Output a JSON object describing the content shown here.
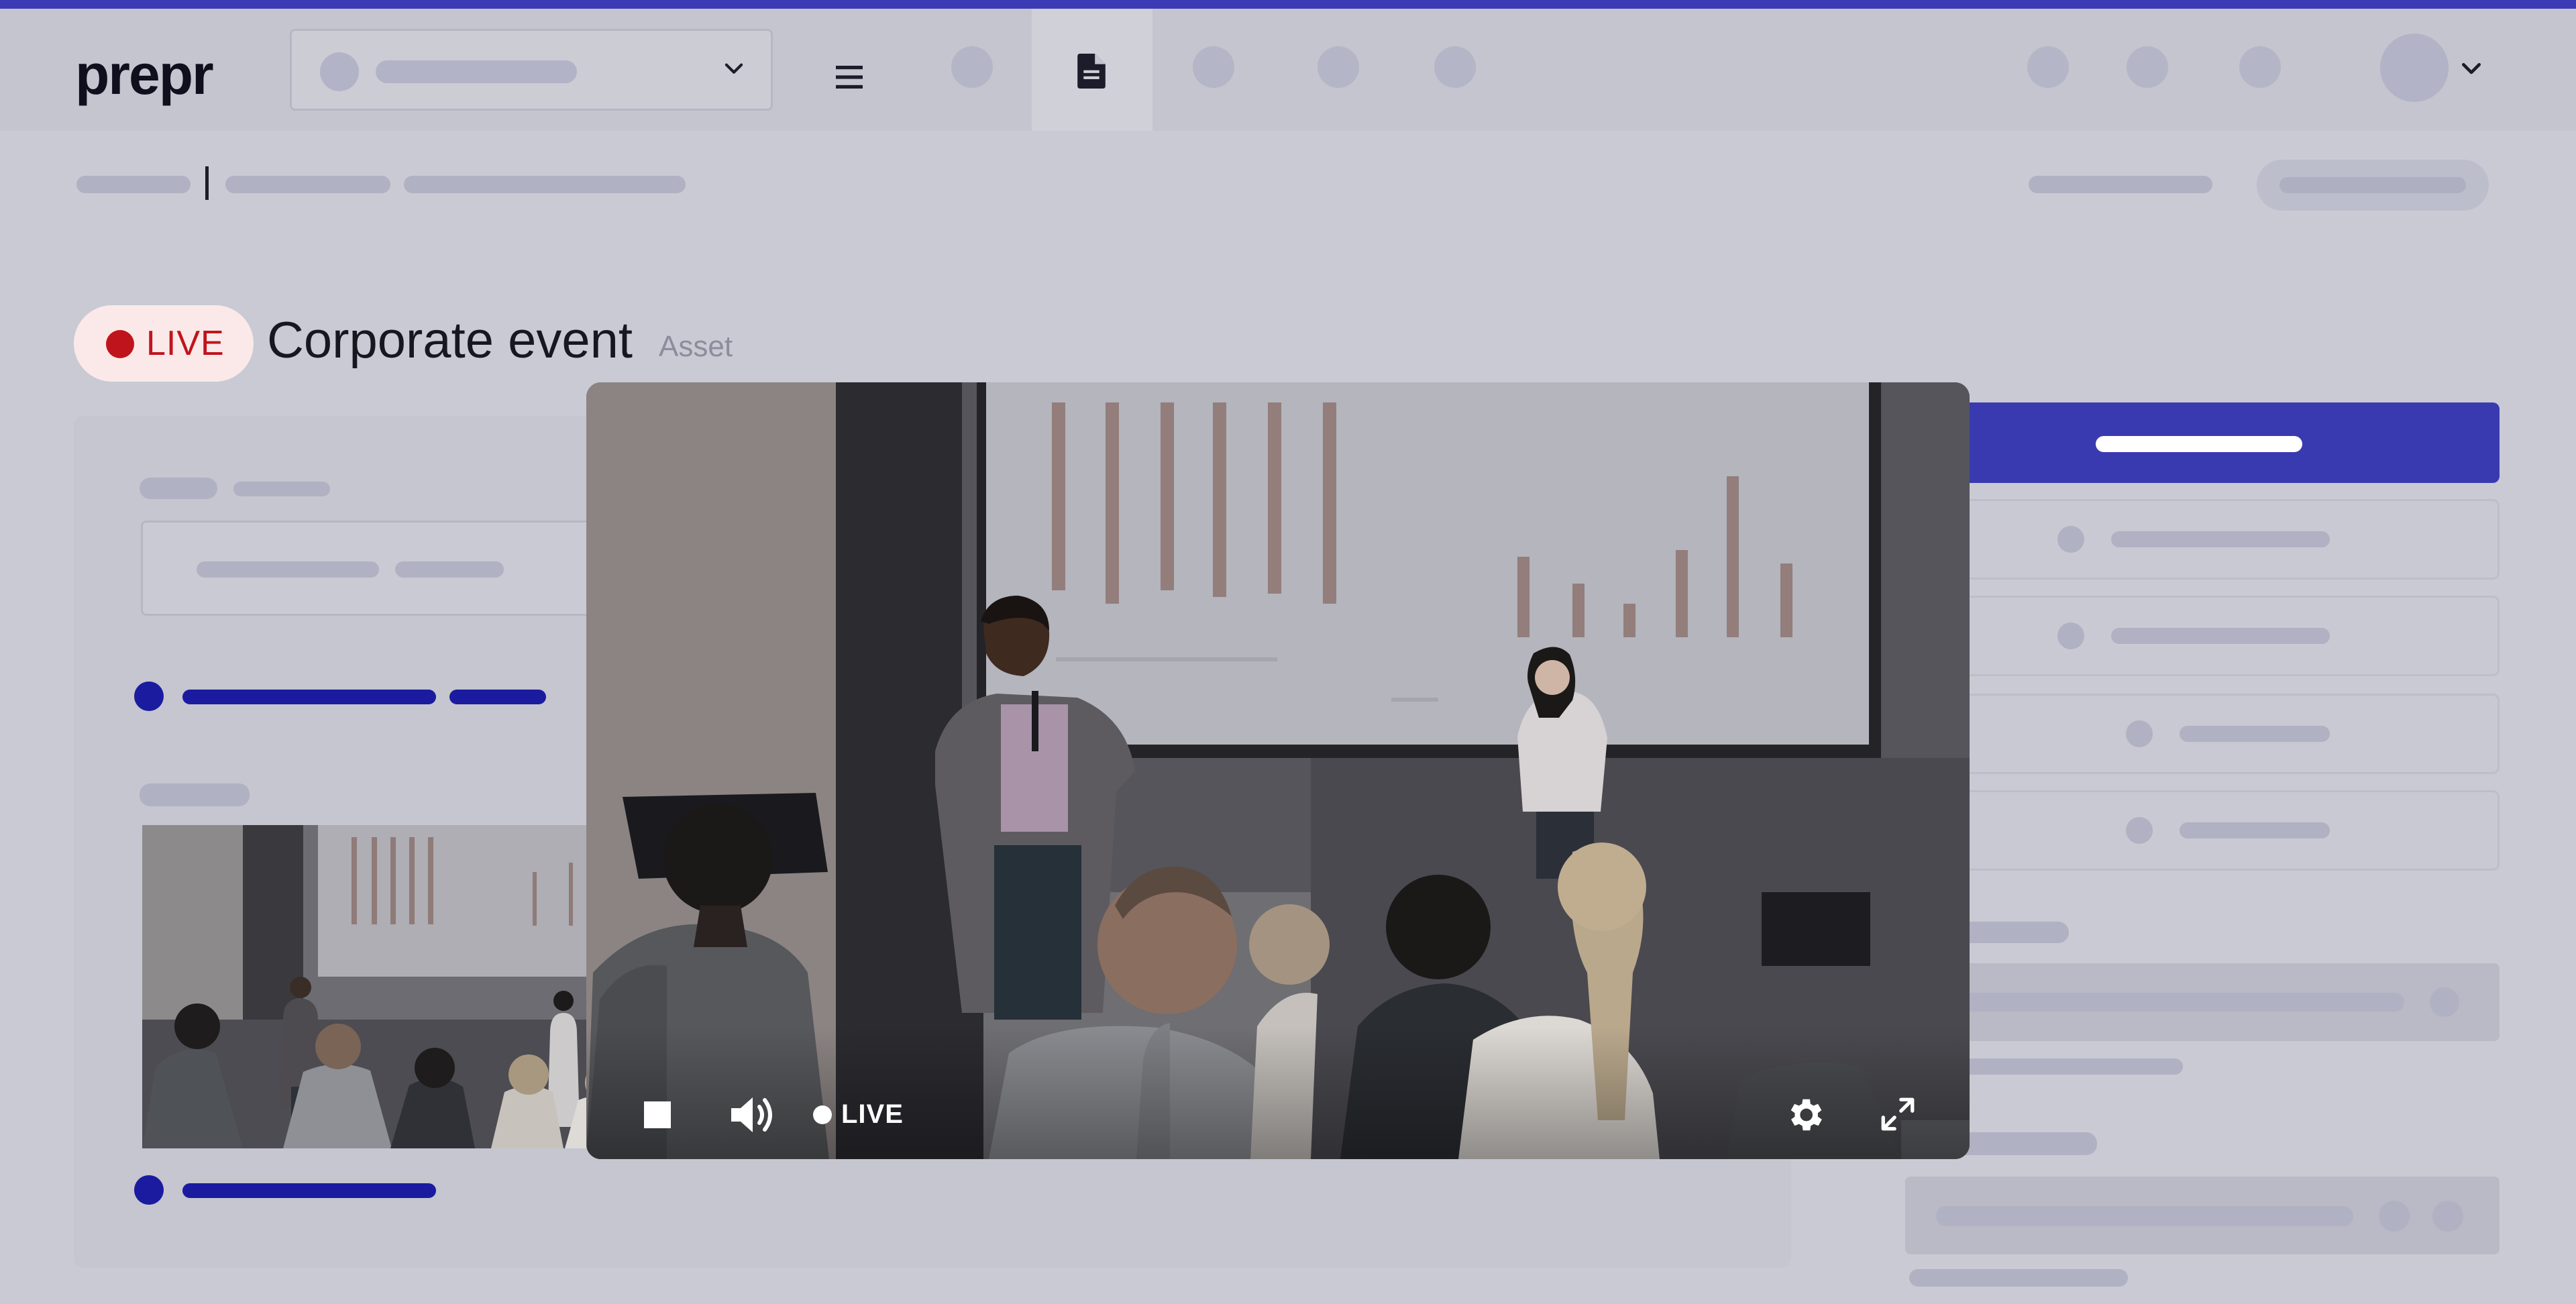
{
  "app": {
    "logo_text": "prepr",
    "accent_color": "#3b3bb5",
    "live_color": "#c0141c"
  },
  "header": {
    "icons": [
      "chevron-down-icon",
      "menu-icon",
      "document-icon",
      "avatar",
      "chevron-down-icon"
    ]
  },
  "page": {
    "live_badge": "LIVE",
    "title": "Corporate event",
    "subtitle": "Asset"
  },
  "player": {
    "live_label": "LIVE",
    "icons": [
      "stop-icon",
      "volume-icon",
      "settings-gear-icon",
      "fullscreen-icon"
    ]
  }
}
